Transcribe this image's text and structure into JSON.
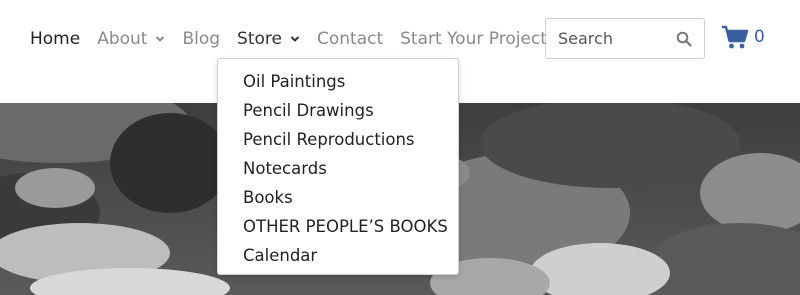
{
  "nav": {
    "home": "Home",
    "about": "About",
    "blog": "Blog",
    "store": "Store",
    "contact": "Contact",
    "start_project": "Start Your Project"
  },
  "search": {
    "placeholder": "Search"
  },
  "cart": {
    "count": "0"
  },
  "store_menu": {
    "items": [
      "Oil Paintings",
      "Pencil Drawings",
      "Pencil Reproductions",
      "Notecards",
      "Books",
      "OTHER PEOPLE’S BOOKS",
      "Calendar"
    ]
  },
  "colors": {
    "cart_accent": "#3a5f9e",
    "active_text": "#222222",
    "inactive_text": "#8a8a8a"
  },
  "icons": [
    "chevron-down-icon",
    "search-icon",
    "cart-icon"
  ]
}
